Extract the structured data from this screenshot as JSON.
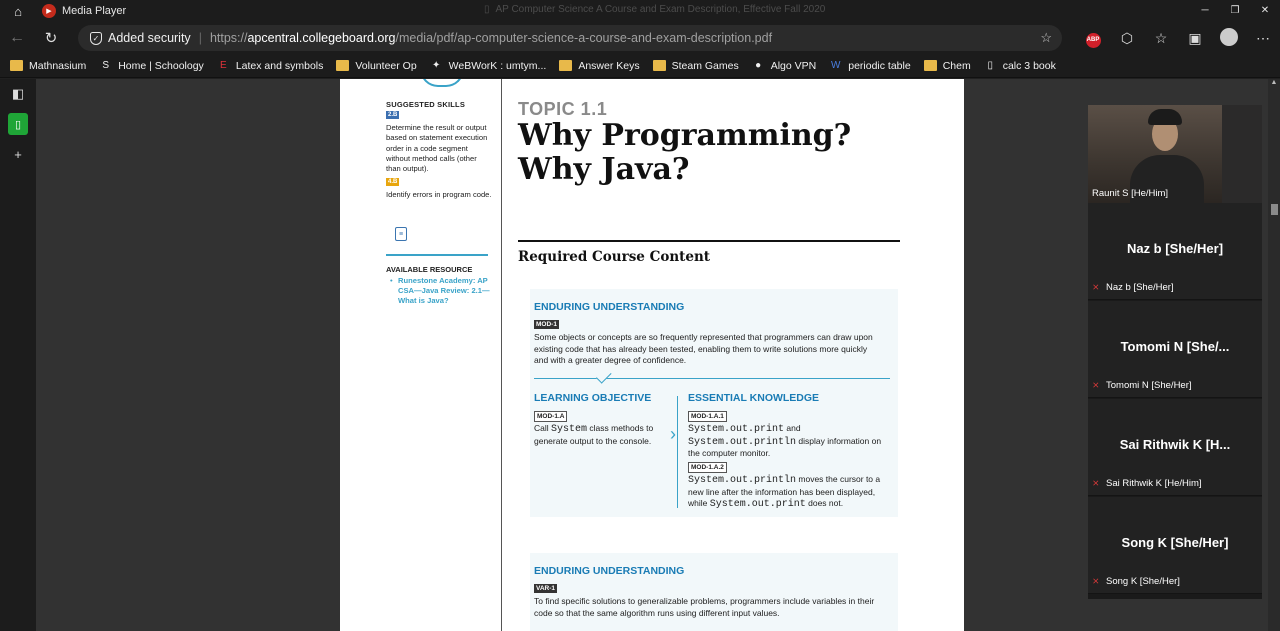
{
  "titlebar": {
    "app_name": "Media Player",
    "document_title": "AP Computer Science A Course and Exam Description, Effective Fall 2020"
  },
  "address": {
    "security_label": "Added security",
    "url_protocol": "https://",
    "url_domain": "apcentral.collegeboard.org",
    "url_path": "/media/pdf/ap-computer-science-a-course-and-exam-description.pdf",
    "adblock_label": "ABP"
  },
  "bookmarks": [
    {
      "label": "Mathnasium",
      "icon": "folder-icon"
    },
    {
      "label": "Home | Schoology",
      "icon": "schoology-icon"
    },
    {
      "label": "Latex and symbols",
      "icon": "latex-icon"
    },
    {
      "label": "Volunteer Op",
      "icon": "folder-icon"
    },
    {
      "label": "WeBWorK : umtym...",
      "icon": "webwork-icon"
    },
    {
      "label": "Answer Keys",
      "icon": "folder-icon"
    },
    {
      "label": "Steam Games",
      "icon": "folder-icon"
    },
    {
      "label": "Algo VPN",
      "icon": "github-icon"
    },
    {
      "label": "periodic table",
      "icon": "periodic-icon"
    },
    {
      "label": "Chem",
      "icon": "folder-icon"
    },
    {
      "label": "calc 3 book",
      "icon": "page-icon"
    }
  ],
  "pdf": {
    "suggested_skills_heading": "SUGGESTED SKILLS",
    "skill1_badge": "2.B",
    "skill1_text": "Determine the result or output based on statement execution order in a code segment without method calls (other than output).",
    "skill2_badge": "4.B",
    "skill2_text": "Identify errors in program code.",
    "resource_heading": "AVAILABLE RESOURCE",
    "resource_link": "Runestone Academy: AP CSA—Java Review: 2.1—What is Java?",
    "topic": "TOPIC 1.1",
    "title_line1": "Why Programming?",
    "title_line2": "Why Java?",
    "required_content": "Required Course Content",
    "eu1_heading": "ENDURING UNDERSTANDING",
    "eu1_tag": "MOD-1",
    "eu1_text": "Some objects or concepts are so frequently represented that programmers can draw upon existing code that has already been tested, enabling them to write solutions more quickly and with a greater degree of confidence.",
    "lo_heading": "LEARNING OBJECTIVE",
    "lo_tag": "MOD-1.A",
    "lo_text_pre": "Call ",
    "lo_text_code": "System",
    "lo_text_post": " class methods to generate output to the console.",
    "ek_heading": "ESSENTIAL KNOWLEDGE",
    "ek1_tag": "MOD-1.A.1",
    "ek1_code1": "System.out.print",
    "ek1_and": " and ",
    "ek1_code2": "System.out.println",
    "ek1_text": " display information on the computer monitor.",
    "ek2_tag": "MOD-1.A.2",
    "ek2_code1": "System.out.println",
    "ek2_text": " moves the cursor to a new line after the information has been displayed, while ",
    "ek2_code2": "System.out.print",
    "ek2_text_end": " does not.",
    "eu2_heading": "ENDURING UNDERSTANDING",
    "eu2_tag": "VAR-1",
    "eu2_text": "To find specific solutions to generalizable problems, programmers include variables in their code so that the same algorithm runs using different input values."
  },
  "participants": [
    {
      "display": "",
      "label": "Raunit S [He/Him]",
      "has_video": true
    },
    {
      "display": "Naz b [She/Her]",
      "label": "Naz b [She/Her]",
      "has_video": false
    },
    {
      "display": "Tomomi N [She/...",
      "label": "Tomomi N [She/Her]",
      "has_video": false
    },
    {
      "display": "Sai Rithwik K [H...",
      "label": "Sai Rithwik K [He/Him]",
      "has_video": false
    },
    {
      "display": "Song K [She/Her]",
      "label": "Song K [She/Her]",
      "has_video": false
    }
  ],
  "colors": {
    "accent_blue": "#1a7cb5",
    "link_blue": "#3aa3c8",
    "sidebar_active": "#1fa537"
  }
}
